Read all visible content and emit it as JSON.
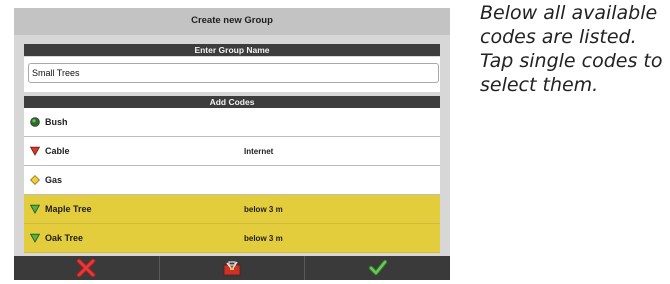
{
  "dialog": {
    "title": "Create new Group"
  },
  "group_name": {
    "header": "Enter Group Name",
    "value": "Small Trees"
  },
  "codes": {
    "header": "Add Codes",
    "items": [
      {
        "name": "Bush",
        "attribute": "",
        "icon": "green-circle-icon",
        "selected": false
      },
      {
        "name": "Cable",
        "attribute": "Internet",
        "icon": "red-triangle-icon",
        "selected": false
      },
      {
        "name": "Gas",
        "attribute": "",
        "icon": "yellow-diamond-icon",
        "selected": false
      },
      {
        "name": "Maple Tree",
        "attribute": "below 3 m",
        "icon": "green-triangle-icon",
        "selected": true
      },
      {
        "name": "Oak Tree",
        "attribute": "below 3 m",
        "icon": "green-triangle-icon",
        "selected": true
      }
    ]
  },
  "bottom_bar": {
    "buttons": [
      "cancel-x-icon",
      "toolbox-icon",
      "confirm-check-icon"
    ]
  },
  "side_note": {
    "text": "Below all available codes are listed. Tap single codes to select them."
  },
  "colors": {
    "selected_row": "#e4cd3c",
    "header_bar": "#3d3d3d",
    "bottom_bar": "#3a3a3a"
  }
}
